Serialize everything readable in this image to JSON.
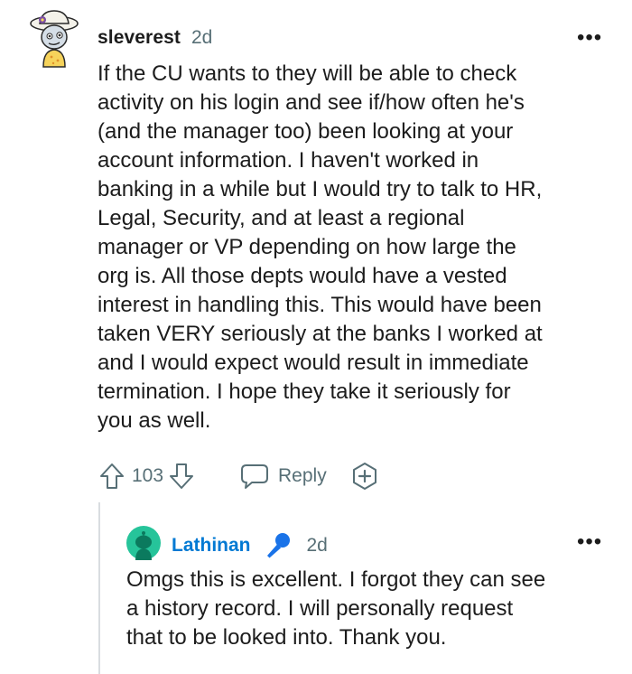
{
  "comments": [
    {
      "username": "sleverest",
      "time": "2d",
      "more": "•••",
      "body": "If the CU wants to they will be able to check\nactivity on his login and see if/how often he's\n(and the manager too) been looking at your\naccount information. I haven't worked in\nbanking in a while but I would try to talk to HR,\nLegal, Security, and at least a regional\nmanager or VP depending on how large the\norg is. All those depts would have a vested\ninterest in handling this. This would have been\ntaken VERY seriously at the banks I worked at\nand I would expect would result in immediate\ntermination. I hope they take it seriously for\nyou as well.",
      "score": "103",
      "reply_label": "Reply"
    },
    {
      "username": "Lathinan",
      "time": "2d",
      "more": "•••",
      "body": "Omgs this is excellent. I forgot they can see\na history record. I will personally request\nthat to be looked into. Thank you."
    }
  ],
  "icons": {
    "upvote": "arrow-up-icon",
    "downvote": "arrow-down-icon",
    "reply": "speech-bubble-icon",
    "award": "add-award-icon",
    "flair": "microphone-icon"
  },
  "colors": {
    "text": "#1c1c1c",
    "meta": "#576f76",
    "username_link": "#0079d3",
    "avatar_teal": "#26c49a",
    "thread_line": "#d9dde0"
  }
}
